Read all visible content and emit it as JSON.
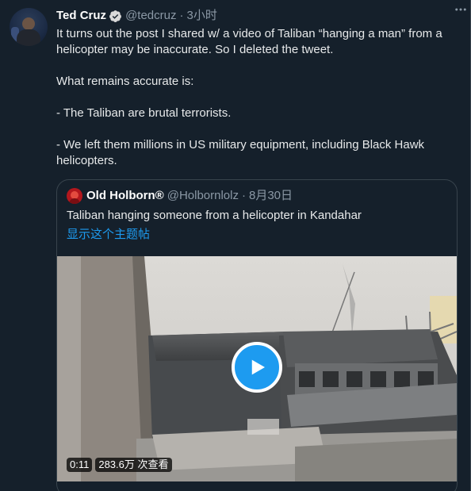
{
  "tweet": {
    "author_name": "Ted Cruz",
    "handle": "@tedcruz",
    "separator": "·",
    "time": "3小时",
    "text": "It turns out the post I shared w/ a video of Taliban “hanging a man” from a helicopter may be inaccurate. So I deleted the tweet.\n\nWhat remains accurate is:\n\n- The Taliban are brutal terrorists.\n\n- We left them millions in US military equipment, including Black Hawk helicopters."
  },
  "quoted": {
    "author_name": "Old Holborn®",
    "handle": "@Holbornlolz",
    "separator": "·",
    "time": "8月30日",
    "text": "Taliban hanging someone from a helicopter in Kandahar",
    "show_thread": "显示这个主题帖",
    "video": {
      "duration": "0:11",
      "views": "283.6万 次查看"
    }
  },
  "icons": {
    "verified": "verified-badge-icon",
    "more": "more-options-icon",
    "play": "play-icon"
  },
  "colors": {
    "background": "#15202b",
    "accent": "#1d9bf0",
    "text_primary": "#e7e9ea",
    "text_secondary": "#8b98a5",
    "border": "#38444d"
  }
}
